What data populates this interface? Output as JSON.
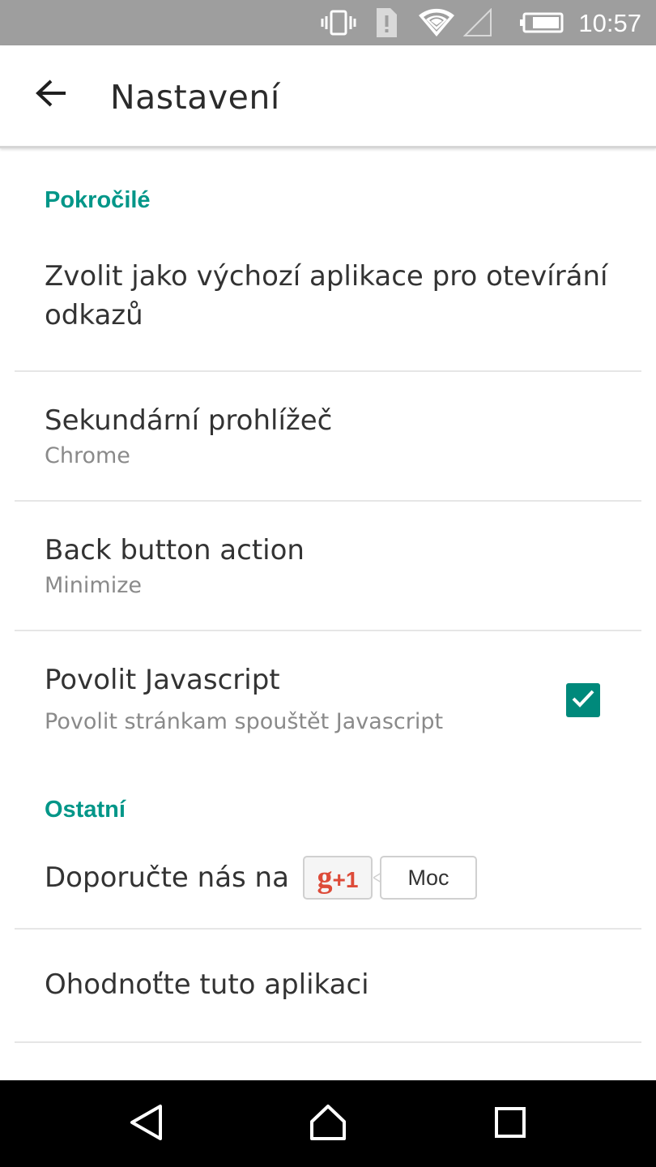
{
  "status_bar": {
    "time": "10:57",
    "icons": [
      "vibrate-icon",
      "sim-alert-icon",
      "wifi-icon",
      "cell-signal-icon",
      "battery-icon"
    ]
  },
  "app_bar": {
    "title": "Nastavení",
    "back_icon": "arrow-back-icon"
  },
  "sections": {
    "advanced": {
      "header": "Pokročilé",
      "default_app": {
        "title": "Zvolit jako výchozí aplikace pro otevírání odkazů"
      },
      "secondary_browser": {
        "title": "Sekundární prohlížeč",
        "summary": "Chrome"
      },
      "back_button": {
        "title": "Back button action",
        "summary": "Minimize"
      },
      "javascript": {
        "title": "Povolit Javascript",
        "summary": "Povolit stránkam spouštět Javascript",
        "checked": true
      }
    },
    "other": {
      "header": "Ostatní",
      "recommend": {
        "title": "Doporučte nás na",
        "gplus_g": "g",
        "gplus_plus": "+1",
        "count": "Moc"
      },
      "rate": {
        "title": "Ohodnoťte tuto aplikaci"
      }
    }
  },
  "nav_bar": {
    "icons": [
      "nav-back-icon",
      "nav-home-icon",
      "nav-recents-icon"
    ]
  },
  "colors": {
    "accent": "#009688",
    "checkbox": "#00897b",
    "status_bar": "#9e9e9e",
    "gplus_red": "#dd4b39"
  }
}
